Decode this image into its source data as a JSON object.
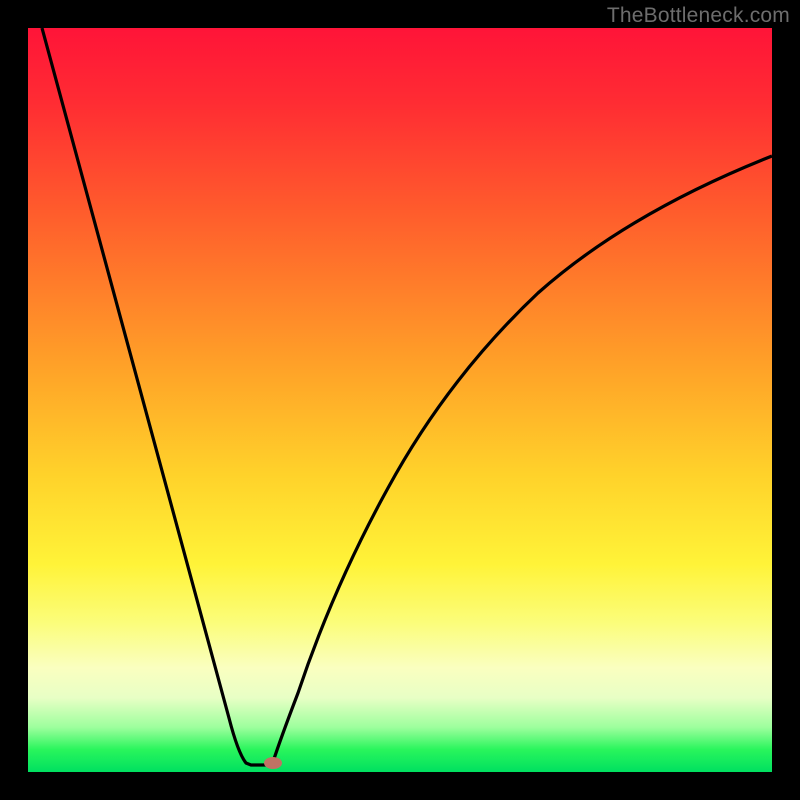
{
  "watermark": "TheBottleneck.com",
  "colors": {
    "frame": "#000000",
    "curve": "#000000",
    "dot": "#c17264",
    "watermark_text": "#6d6d6d"
  },
  "chart_data": {
    "type": "line",
    "title": "",
    "xlabel": "",
    "ylabel": "",
    "xlim": [
      0,
      100
    ],
    "ylim": [
      0,
      100
    ],
    "series": [
      {
        "name": "bottleneck-curve",
        "x": [
          0,
          5,
          10,
          15,
          20,
          24,
          27,
          29,
          30,
          31,
          32,
          34,
          37,
          42,
          50,
          60,
          70,
          80,
          90,
          100
        ],
        "values": [
          100,
          84,
          68,
          52,
          36,
          22,
          10,
          3,
          0,
          0,
          2,
          8,
          18,
          32,
          48,
          61,
          70,
          76,
          80,
          83
        ]
      }
    ],
    "marker": {
      "x": 31,
      "y": 0,
      "name": "optimal-point"
    },
    "gradient_meaning": "red=high bottleneck, green=low bottleneck",
    "note": "values read from chart pixels; axes are unlabeled so 0–100 normalized scale assumed"
  }
}
